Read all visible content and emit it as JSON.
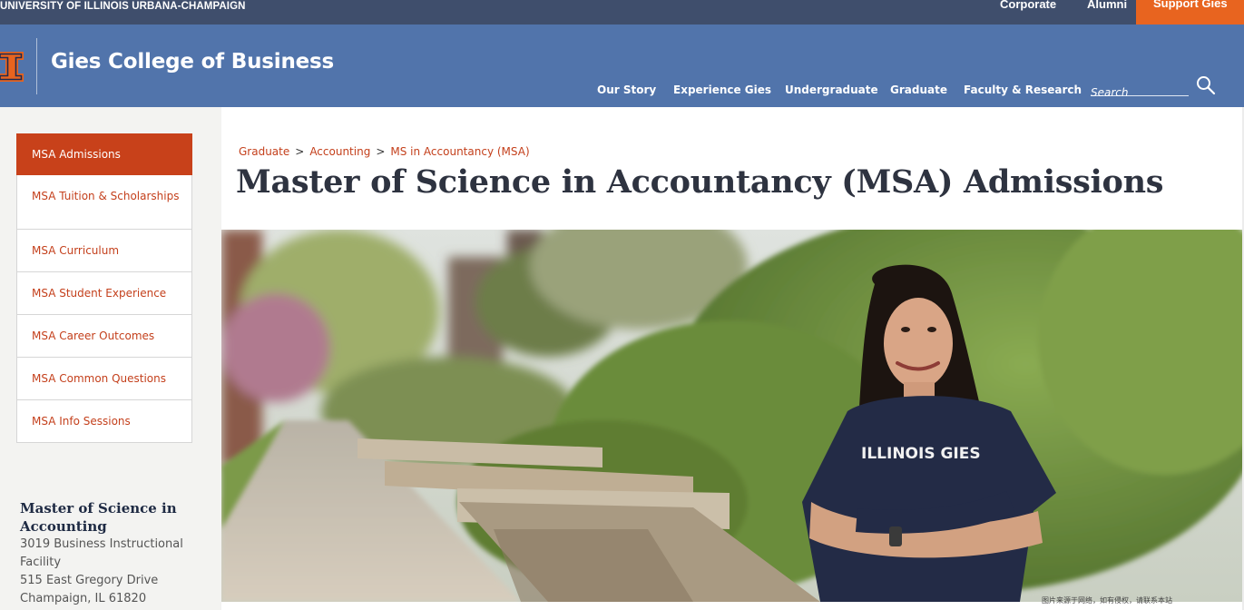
{
  "topbar": {
    "university": "UNIVERSITY OF ILLINOIS URBANA-CHAMPAIGN",
    "corporate": "Corporate",
    "alumni": "Alumni",
    "support": "Support Gies",
    "bg_color": "#3f4e6c",
    "support_color": "#e8641f"
  },
  "header": {
    "brand": "Gies College of Business",
    "bg_color": "#5174ab",
    "logo_icon": "block-i-icon",
    "nav": [
      "Our Story",
      "Experience Gies",
      "Undergraduate",
      "Graduate",
      "Faculty & Research"
    ],
    "search_placeholder": "Search"
  },
  "sidebar": {
    "items": [
      {
        "label": "MSA Admissions",
        "active": true
      },
      {
        "label": "MSA Tuition & Scholarships",
        "active": false
      },
      {
        "label": "MSA Curriculum",
        "active": false
      },
      {
        "label": "MSA Student Experience",
        "active": false
      },
      {
        "label": "MSA Career Outcomes",
        "active": false
      },
      {
        "label": "MSA Common Questions",
        "active": false
      },
      {
        "label": "MSA Info Sessions",
        "active": false
      }
    ],
    "address": {
      "title": "Master of Science in Accounting",
      "line1": "3019 Business Instructional",
      "line2": "Facility",
      "line3": "515 East Gregory Drive",
      "line4": "Champaign, IL 61820"
    }
  },
  "main": {
    "breadcrumb": [
      "Graduate",
      "Accounting",
      "MS in Accountancy (MSA)"
    ],
    "breadcrumb_sep": ">",
    "title": "Master of Science in Accountancy (MSA) Admissions",
    "hero": {
      "shirt_text": "ILLINOIS GIES",
      "caption": "图片来源于网络，如有侵权，请联系本站"
    }
  }
}
